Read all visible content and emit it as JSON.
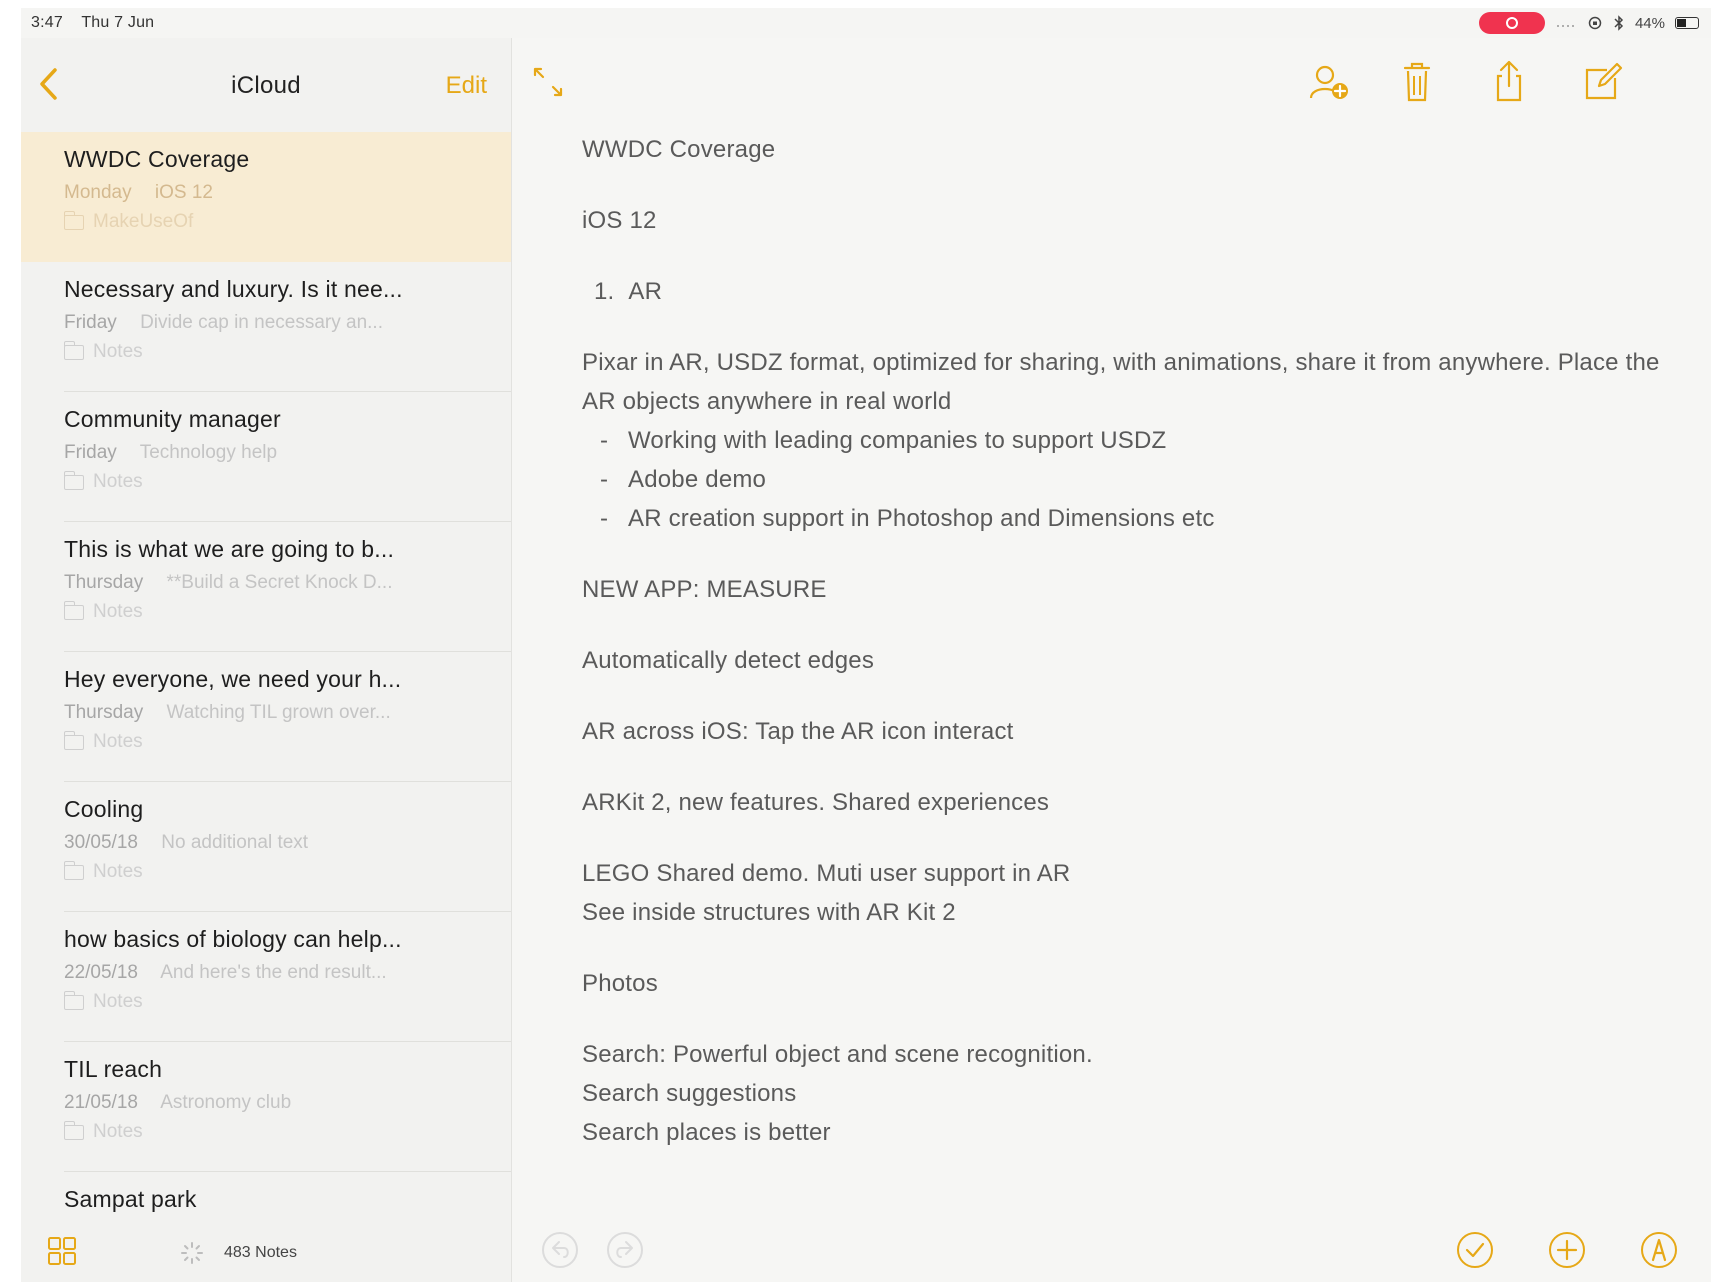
{
  "status_bar": {
    "time": "3:47",
    "date": "Thu 7 Jun",
    "battery": "44%"
  },
  "sidebar": {
    "title": "iCloud",
    "edit_label": "Edit",
    "notes": [
      {
        "title": "WWDC Coverage",
        "date": "Monday",
        "preview": "iOS 12",
        "folder": "MakeUseOf",
        "selected": true
      },
      {
        "title": "Necessary and luxury. Is it nee...",
        "date": "Friday",
        "preview": "Divide cap in necessary an...",
        "folder": "Notes"
      },
      {
        "title": "Community manager",
        "date": "Friday",
        "preview": "Technology help",
        "folder": "Notes"
      },
      {
        "title": "This is what we are going to b...",
        "date": "Thursday",
        "preview": "**Build a Secret Knock D...",
        "folder": "Notes"
      },
      {
        "title": "Hey everyone, we need your h...",
        "date": "Thursday",
        "preview": "Watching TIL grown over...",
        "folder": "Notes"
      },
      {
        "title": "Cooling",
        "date": "30/05/18",
        "preview": "No additional text",
        "folder": "Notes"
      },
      {
        "title": "how basics of biology can help...",
        "date": "22/05/18",
        "preview": "And here's the end result...",
        "folder": "Notes"
      },
      {
        "title": "TIL reach",
        "date": "21/05/18",
        "preview": "Astronomy club",
        "folder": "Notes"
      },
      {
        "title": "Sampat park",
        "date": "",
        "preview": "",
        "folder": ""
      }
    ],
    "footer": {
      "count_label": "483 Notes"
    }
  },
  "note": {
    "title": "WWDC Coverage",
    "heading": "iOS 12",
    "list_number": "1.",
    "list_item": "AR",
    "para1": "Pixar in AR, USDZ format, optimized for sharing, with animations, share it from anywhere. Place the AR objects anywhere in real world",
    "bullets": [
      "Working with leading companies to support USDZ",
      "Adobe demo",
      "AR creation support in Photoshop and Dimensions etc"
    ],
    "bullet_marker": "-",
    "measure": "NEW APP: MEASURE",
    "edges": "Automatically detect edges",
    "across": "AR across iOS: Tap the AR icon interact",
    "arkit": "ARKit 2, new features. Shared experiences",
    "lego1": "LEGO Shared demo. Muti user support in AR",
    "lego2": "See inside structures with AR Kit 2",
    "photos": "Photos",
    "search1": "Search: Powerful object and scene recognition.",
    "search2": "Search suggestions",
    "search3": "Search places is better"
  },
  "colors": {
    "accent": "#e6a817",
    "selected_row": "#f8ecd3",
    "record_pill": "#f0334f"
  }
}
